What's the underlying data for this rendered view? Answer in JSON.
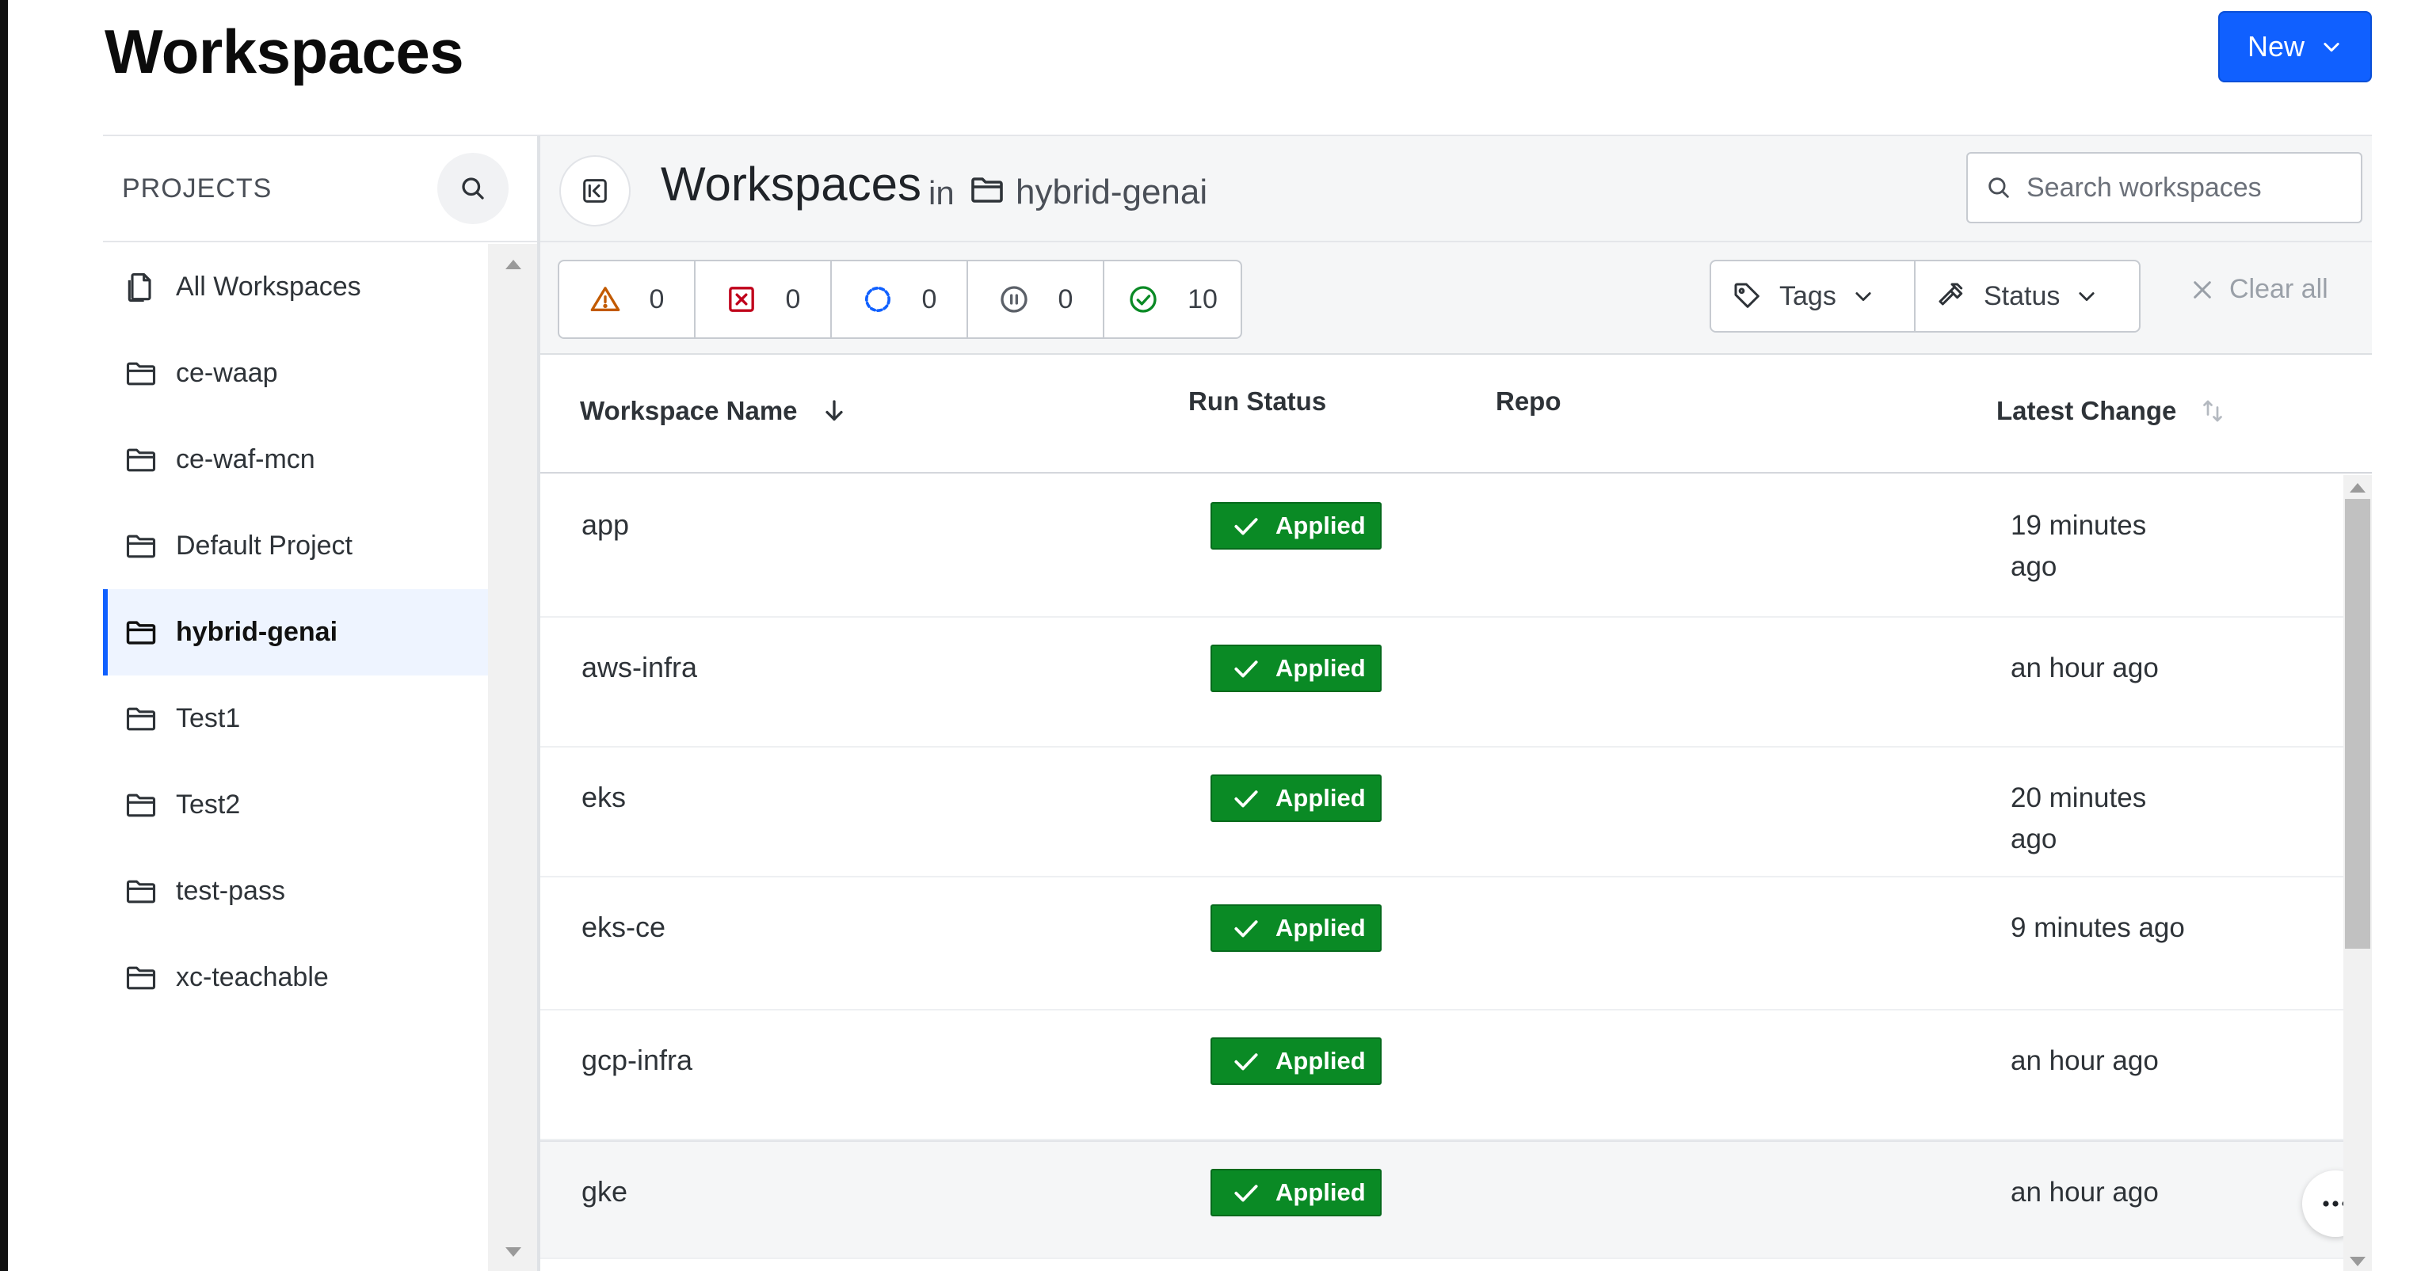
{
  "page": {
    "title": "Workspaces",
    "new_button": "New"
  },
  "sidebar": {
    "heading": "PROJECTS",
    "items": [
      {
        "label": "All Workspaces",
        "icon": "copy-icon"
      },
      {
        "label": "ce-waap",
        "icon": "folder-icon"
      },
      {
        "label": "ce-waf-mcn",
        "icon": "folder-icon"
      },
      {
        "label": "Default Project",
        "icon": "folder-icon"
      },
      {
        "label": "hybrid-genai",
        "icon": "folder-icon",
        "active": true
      },
      {
        "label": "Test1",
        "icon": "folder-icon"
      },
      {
        "label": "Test2",
        "icon": "folder-icon"
      },
      {
        "label": "test-pass",
        "icon": "folder-icon"
      },
      {
        "label": "xc-teachable",
        "icon": "folder-icon"
      }
    ]
  },
  "main": {
    "title": "Workspaces",
    "in_word": "in",
    "project": "hybrid-genai",
    "search_placeholder": "Search workspaces",
    "counters": [
      {
        "icon": "warning-icon",
        "value": "0",
        "color": "#c25a00"
      },
      {
        "icon": "error-icon",
        "value": "0",
        "color": "#c0001a"
      },
      {
        "icon": "running-icon",
        "value": "0",
        "color": "#1060ff"
      },
      {
        "icon": "paused-icon",
        "value": "0",
        "color": "#5b6068"
      },
      {
        "icon": "success-icon",
        "value": "10",
        "color": "#0a8a25"
      }
    ],
    "filters": {
      "tags": "Tags",
      "status": "Status",
      "clear": "Clear all"
    },
    "columns": {
      "name": "Workspace Name",
      "run_status": "Run Status",
      "repo": "Repo",
      "latest_change": "Latest Change"
    },
    "rows": [
      {
        "name": "app",
        "status": "Applied",
        "repo": "",
        "latest_change": "19 minutes ago"
      },
      {
        "name": "aws-infra",
        "status": "Applied",
        "repo": "",
        "latest_change": "an hour ago"
      },
      {
        "name": "eks",
        "status": "Applied",
        "repo": "",
        "latest_change": "20 minutes ago"
      },
      {
        "name": "eks-ce",
        "status": "Applied",
        "repo": "",
        "latest_change": "9 minutes ago"
      },
      {
        "name": "gcp-infra",
        "status": "Applied",
        "repo": "",
        "latest_change": "an hour ago"
      },
      {
        "name": "gke",
        "status": "Applied",
        "repo": "",
        "latest_change": "an hour ago"
      }
    ]
  },
  "colors": {
    "accent": "#1060ff",
    "success": "#0a8a25",
    "active_bg": "#eef4ff"
  }
}
